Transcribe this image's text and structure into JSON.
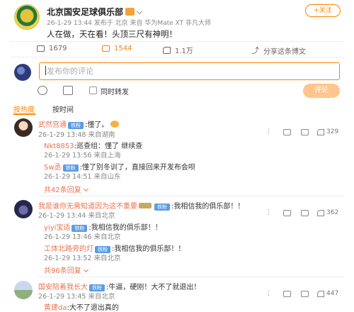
{
  "post": {
    "author": "北京国安足球俱乐部",
    "meta": "26-1-29 13:44 发布于 北京 来自 华为Mate XT 非凡大师",
    "follow_label": "+关注",
    "text": "人在做，天在看！头顶三尺有神明！",
    "stats": {
      "reposts": "1679",
      "comments": "1544",
      "likes": "1.1万",
      "share": "分享这条博文"
    }
  },
  "composer": {
    "placeholder": "发布你的评论",
    "repost_label": "同时转发",
    "submit_label": "评论"
  },
  "tabs": [
    {
      "label": "按热度",
      "active": true
    },
    {
      "label": "按时间",
      "active": false
    }
  ],
  "comments": [
    {
      "name": "武然宫通",
      "badge": "铁粉",
      "text": ":懂了。",
      "meta": "26-1-29 13:48 来自湖南",
      "likes": "329",
      "replies": [
        {
          "name": "Nkt8853",
          "text": ":巡查组：懂了 继续查",
          "meta": "26-1-29 13:56 来自上海"
        },
        {
          "name": "Sw丞",
          "badge": "铁粉",
          "text": ":懂了别冬训了，直接回来开发布会呗",
          "meta": "26-1-29 14:51 来自山东"
        }
      ],
      "total": "共42条回复"
    },
    {
      "name": "我是谁你无需知道因为这不重要",
      "badge": "铁粉",
      "text": ":我相信我的俱乐部！！",
      "meta": "26-1-29 13:44 来自北京",
      "likes": "362",
      "replies": [
        {
          "name": "yiyi宝适",
          "badge": "铁粉",
          "text": ":我相信我的俱乐部！！",
          "meta": "26-1-29 13:46 来自北京"
        },
        {
          "name": "工体北路旁的灯",
          "badge": "铁粉",
          "text": ":我相信我的俱乐部！！",
          "meta": "26-1-29 13:52 来自北京"
        }
      ],
      "total": "共96条回复"
    },
    {
      "name": "国安陪着我长大",
      "badge": "铁粉",
      "text": ":牛逼，硬刚！大不了就退出！",
      "meta": "26-1-29 13:45 来自北京",
      "likes": "447",
      "replies": [
        {
          "name": "黄建da",
          "text": ":大不了退出真的",
          "meta": ""
        }
      ]
    }
  ],
  "colors": {
    "accent": "#ff8200",
    "name": "#eb7350",
    "badge": "#5b9be3"
  }
}
